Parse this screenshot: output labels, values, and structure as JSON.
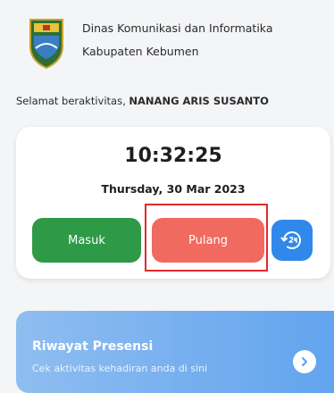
{
  "header": {
    "org_line1": "Dinas Komunikasi dan Informatika",
    "org_line2": "Kabupaten Kebumen"
  },
  "greeting": {
    "prefix": "Selamat beraktivitas,",
    "name": "NANANG ARIS SUSANTO"
  },
  "attendance": {
    "time": "10:32:25",
    "date": "Thursday, 30 Mar 2023",
    "masuk_label": "Masuk",
    "pulang_label": "Pulang",
    "history_icon": "clock-24h-icon"
  },
  "riwayat": {
    "title": "Riwayat Presensi",
    "subtitle": "Cek aktivitas kehadiran anda di sini",
    "arrow_icon": "chevron-right-icon"
  },
  "colors": {
    "masuk": "#2e9a47",
    "pulang": "#f06a60",
    "history": "#2f88ea",
    "highlight": "#e02b2b",
    "riwayat": "#62a4ee"
  }
}
